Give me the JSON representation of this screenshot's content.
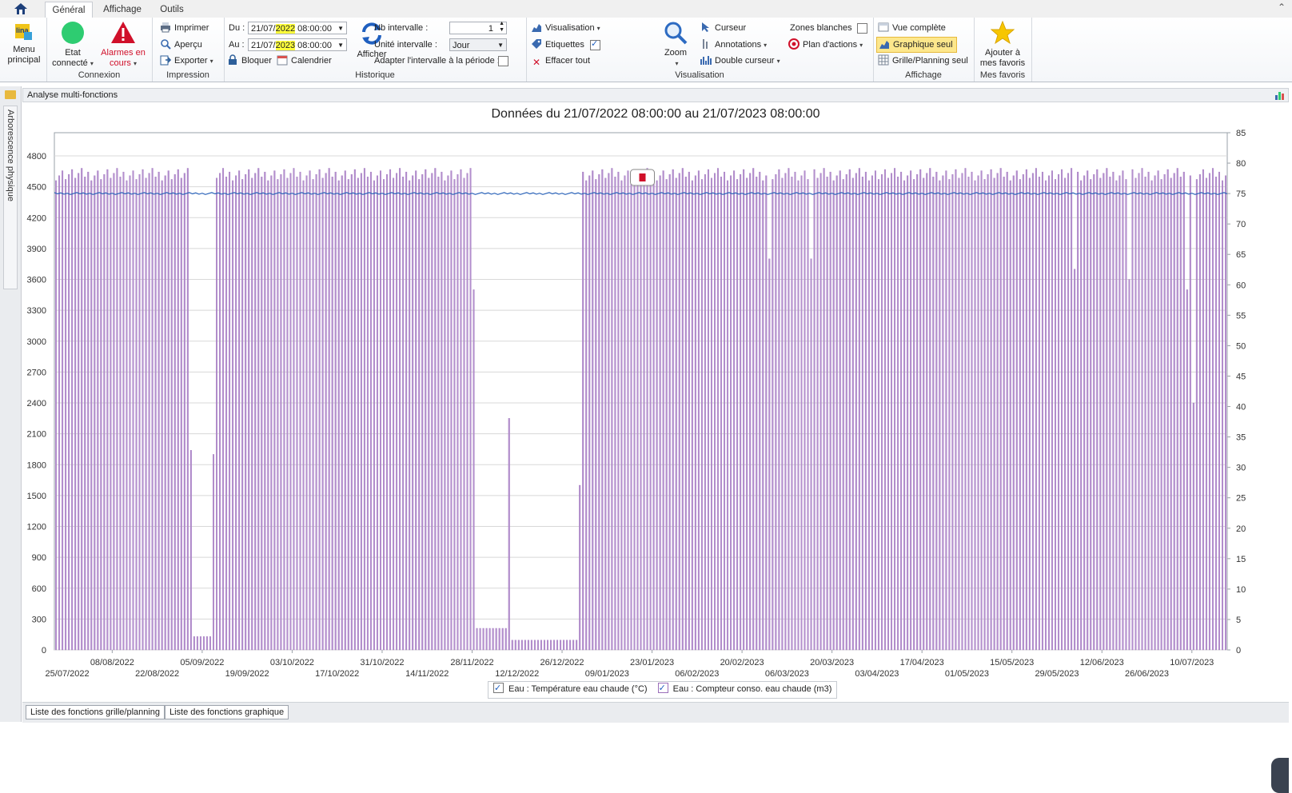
{
  "tabs": [
    {
      "label": "Général",
      "active": true
    },
    {
      "label": "Affichage",
      "active": false
    },
    {
      "label": "Outils",
      "active": false
    }
  ],
  "ribbon": {
    "menu_principal": {
      "label1": "Menu",
      "label2": "principal"
    },
    "connexion": {
      "group_label": "Connexion",
      "etat_1": "Etat",
      "etat_2": "connecté",
      "alarmes_1": "Alarmes en",
      "alarmes_2": "cours"
    },
    "impression": {
      "group_label": "Impression",
      "imprimer": "Imprimer",
      "apercu": "Aperçu",
      "exporter": "Exporter"
    },
    "historique": {
      "group_label": "Historique",
      "du_label": "Du :",
      "du_pre": "21/07/",
      "du_year": "2022",
      "du_post": " 08:00:00",
      "au_label": "Au :",
      "au_pre": "21/07/",
      "au_year": "2023",
      "au_post": " 08:00:00",
      "bloquer": "Bloquer",
      "calendrier": "Calendrier",
      "afficher": "Afficher",
      "nb_intervalle_label": "Nb intervalle :",
      "nb_intervalle_value": "1",
      "unite_label": "Unité intervalle :",
      "unite_value": "Jour",
      "adapter_label": "Adapter l'intervalle à la période :"
    },
    "visualisation": {
      "group_label": "Visualisation",
      "visualisation": "Visualisation",
      "etiquettes": "Etiquettes",
      "effacer": "Effacer tout",
      "zoom": "Zoom",
      "curseur": "Curseur",
      "annotations": "Annotations",
      "double_curseur": "Double curseur",
      "zones_blanches": "Zones blanches",
      "plan_actions": "Plan d'actions"
    },
    "affichage": {
      "group_label": "Affichage",
      "vue_complete": "Vue complète",
      "graphique_seul": "Graphique seul",
      "grille_planning": "Grille/Planning seul"
    },
    "favoris": {
      "group_label": "Mes favoris",
      "ajouter_1": "Ajouter à",
      "ajouter_2": "mes favoris"
    }
  },
  "left_dock": {
    "label": "Arborescence physique"
  },
  "panel": {
    "title": "Analyse multi-fonctions"
  },
  "bottom_tabs": [
    "Liste des fonctions grille/planning",
    "Liste des fonctions graphique"
  ],
  "colors": {
    "bars": "#b48fce",
    "bar_stroke": "#9b6fba",
    "line": "#2a62b8",
    "accent": "#ffff3c"
  },
  "chart_data": {
    "type": "bar",
    "title": "Données du 21/07/2022 08:00:00 au 21/07/2023 08:00:00",
    "y_left": {
      "min": 0,
      "max": 4800,
      "ticks": [
        "0",
        "300",
        "600",
        "900",
        "1200",
        "1500",
        "1800",
        "2100",
        "2400",
        "2700",
        "3000",
        "3300",
        "3600",
        "3900",
        "4200",
        "4500",
        "4800"
      ]
    },
    "y_right": {
      "min": 0,
      "max": 85,
      "ticks": [
        "0",
        "5",
        "10",
        "15",
        "20",
        "25",
        "30",
        "35",
        "40",
        "45",
        "50",
        "55",
        "60",
        "65",
        "70",
        "75",
        "80",
        "85"
      ]
    },
    "x_labels_upper": [
      "08/08/2022",
      "05/09/2022",
      "03/10/2022",
      "31/10/2022",
      "28/11/2022",
      "26/12/2022",
      "23/01/2023",
      "20/02/2023",
      "20/03/2023",
      "17/04/2023",
      "15/05/2023",
      "12/06/2023",
      "10/07/2023"
    ],
    "x_labels_lower": [
      "25/07/2022",
      "22/08/2022",
      "19/09/2022",
      "17/10/2022",
      "14/11/2022",
      "12/12/2022",
      "09/01/2023",
      "06/02/2023",
      "06/03/2023",
      "03/04/2023",
      "01/05/2023",
      "29/05/2023",
      "26/06/2023"
    ],
    "x_start": "2022-07-21",
    "x_end": "2023-07-21",
    "series": [
      {
        "name": "Eau : Température eau chaude (°C)",
        "type": "line",
        "axis": "right",
        "typical_value": 75
      },
      {
        "name": "Eau : Compteur conso. eau chaude (m3)",
        "type": "bar",
        "axis": "left",
        "typical_value": 4620,
        "segments": [
          {
            "from": "2022-07-21",
            "to": "2022-08-31",
            "value": 4620
          },
          {
            "from": "2022-09-01",
            "to": "2022-09-01",
            "value": 1940
          },
          {
            "from": "2022-09-02",
            "to": "2022-09-07",
            "value": 130
          },
          {
            "from": "2022-09-08",
            "to": "2022-09-08",
            "value": 1900
          },
          {
            "from": "2022-09-09",
            "to": "2022-11-27",
            "value": 4620
          },
          {
            "from": "2022-11-28",
            "to": "2022-11-28",
            "value": 3500
          },
          {
            "from": "2022-11-29",
            "to": "2022-12-08",
            "value": 210
          },
          {
            "from": "2022-12-09",
            "to": "2022-12-09",
            "value": 2250
          },
          {
            "from": "2022-12-10",
            "to": "2022-12-30",
            "value": 95
          },
          {
            "from": "2022-12-31",
            "to": "2022-12-31",
            "value": 1600
          },
          {
            "from": "2023-01-01",
            "to": "2023-07-21",
            "value": 4620
          }
        ],
        "dips": [
          {
            "date": "2023-02-28",
            "value": 3800
          },
          {
            "date": "2023-03-13",
            "value": 3800
          },
          {
            "date": "2023-06-03",
            "value": 3700
          },
          {
            "date": "2023-06-20",
            "value": 3600
          },
          {
            "date": "2023-07-08",
            "value": 3500
          },
          {
            "date": "2023-07-10",
            "value": 2400
          }
        ]
      }
    ]
  }
}
